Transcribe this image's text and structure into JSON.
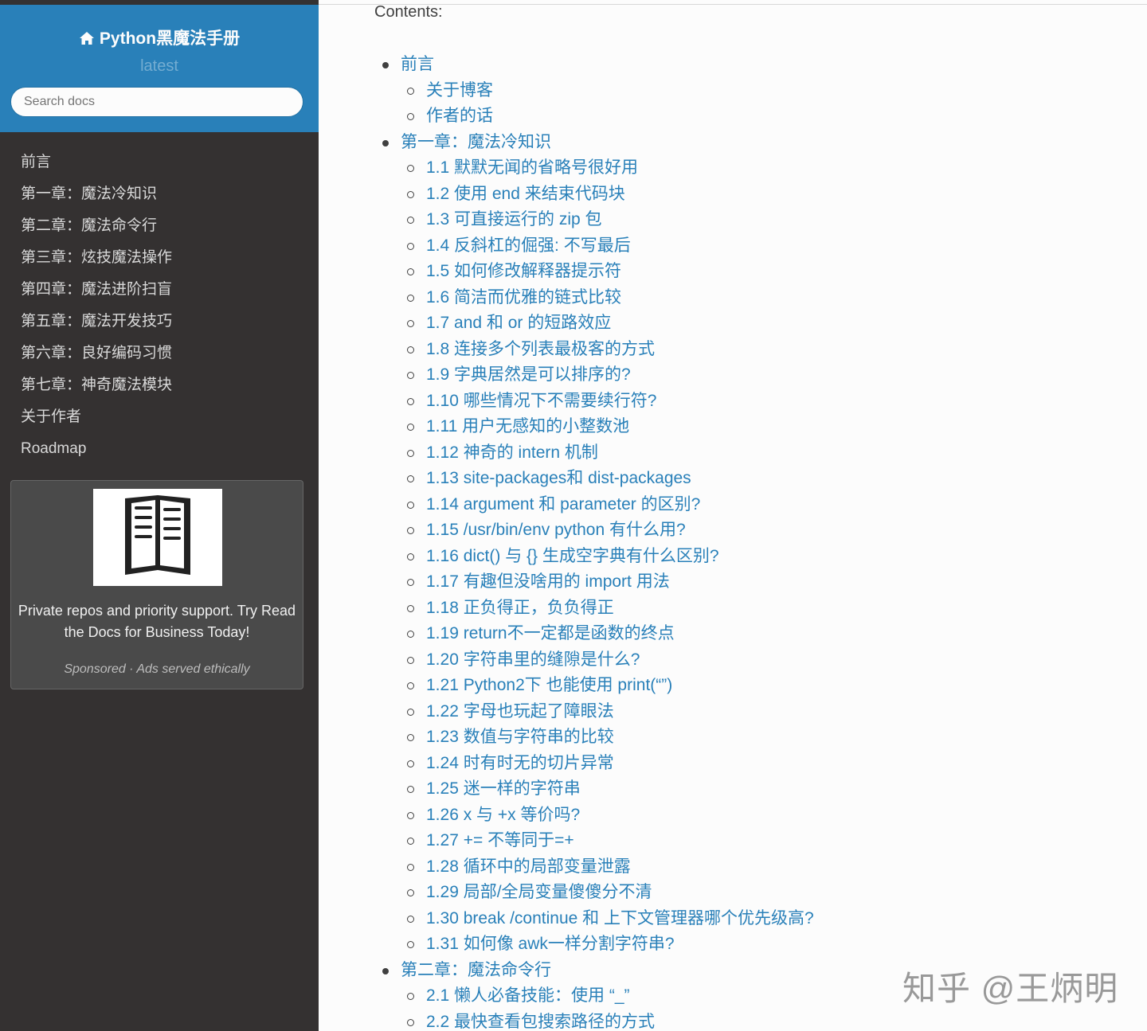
{
  "sidebar": {
    "title": "Python黑魔法手册",
    "version": "latest",
    "search_placeholder": "Search docs",
    "nav": [
      "前言",
      "第一章：魔法冷知识",
      "第二章：魔法命令行",
      "第三章：炫技魔法操作",
      "第四章：魔法进阶扫盲",
      "第五章：魔法开发技巧",
      "第六章：良好编码习惯",
      "第七章：神奇魔法模块",
      "关于作者",
      "Roadmap"
    ],
    "ad": {
      "text": "Private repos and priority support. Try Read the Docs for Business Today!",
      "sponsor": "Sponsored · Ads served ethically"
    }
  },
  "main": {
    "contents_title": "Contents:",
    "toc": [
      {
        "level": 1,
        "text": "前言"
      },
      {
        "level": 2,
        "text": "关于博客"
      },
      {
        "level": 2,
        "text": "作者的话"
      },
      {
        "level": 1,
        "text": "第一章：魔法冷知识"
      },
      {
        "level": 2,
        "text": "1.1 默默无闻的省略号很好用"
      },
      {
        "level": 2,
        "text": "1.2 使用 end 来结束代码块"
      },
      {
        "level": 2,
        "text": "1.3 可直接运行的 zip 包"
      },
      {
        "level": 2,
        "text": "1.4 反斜杠的倔强: 不写最后"
      },
      {
        "level": 2,
        "text": "1.5 如何修改解释器提示符"
      },
      {
        "level": 2,
        "text": "1.6 简洁而优雅的链式比较"
      },
      {
        "level": 2,
        "text": "1.7 and 和 or 的短路效应"
      },
      {
        "level": 2,
        "text": "1.8 连接多个列表最极客的方式"
      },
      {
        "level": 2,
        "text": "1.9 字典居然是可以排序的?"
      },
      {
        "level": 2,
        "text": "1.10 哪些情况下不需要续行符?"
      },
      {
        "level": 2,
        "text": "1.11 用户无感知的小整数池"
      },
      {
        "level": 2,
        "text": "1.12 神奇的 intern 机制"
      },
      {
        "level": 2,
        "text": "1.13 site-packages和 dist-packages"
      },
      {
        "level": 2,
        "text": "1.14 argument 和 parameter 的区别?"
      },
      {
        "level": 2,
        "text": "1.15 /usr/bin/env python 有什么用?"
      },
      {
        "level": 2,
        "text": "1.16 dict() 与 {} 生成空字典有什么区别?"
      },
      {
        "level": 2,
        "text": "1.17 有趣但没啥用的 import 用法"
      },
      {
        "level": 2,
        "text": "1.18 正负得正，负负得正"
      },
      {
        "level": 2,
        "text": "1.19 return不一定都是函数的终点"
      },
      {
        "level": 2,
        "text": "1.20 字符串里的缝隙是什么?"
      },
      {
        "level": 2,
        "text": "1.21 Python2下 也能使用 print(“”)"
      },
      {
        "level": 2,
        "text": "1.22 字母也玩起了障眼法"
      },
      {
        "level": 2,
        "text": "1.23 数值与字符串的比较"
      },
      {
        "level": 2,
        "text": "1.24 时有时无的切片异常"
      },
      {
        "level": 2,
        "text": "1.25 迷一样的字符串"
      },
      {
        "level": 2,
        "text": "1.26 x 与 +x 等价吗?"
      },
      {
        "level": 2,
        "text": "1.27 += 不等同于=+"
      },
      {
        "level": 2,
        "text": "1.28 循环中的局部变量泄露"
      },
      {
        "level": 2,
        "text": "1.29 局部/全局变量傻傻分不清"
      },
      {
        "level": 2,
        "text": "1.30 break /continue 和 上下文管理器哪个优先级高?"
      },
      {
        "level": 2,
        "text": "1.31 如何像 awk一样分割字符串?"
      },
      {
        "level": 1,
        "text": "第二章：魔法命令行"
      },
      {
        "level": 2,
        "text": "2.1 懒人必备技能：使用 “_”"
      },
      {
        "level": 2,
        "text": "2.2 最快查看包搜索路径的方式"
      }
    ]
  },
  "watermark": "知乎 @王炳明",
  "colors": {
    "sidebar_bg": "#343131",
    "header_bg": "#2980b9",
    "link": "#2980b9",
    "text": "#404040"
  }
}
